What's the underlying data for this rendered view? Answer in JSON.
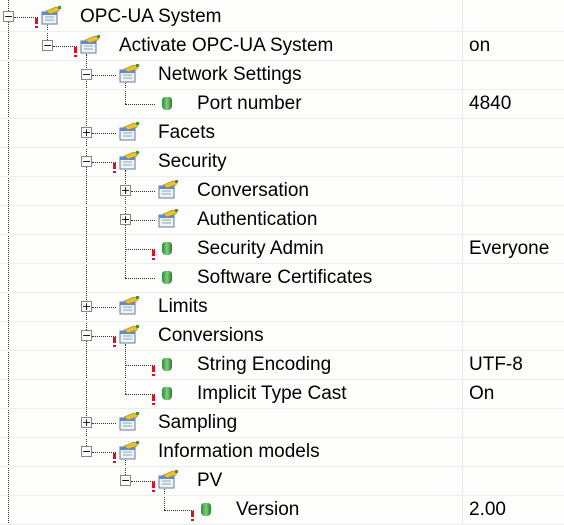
{
  "tree": [
    {
      "level": 0,
      "expander": "minus",
      "flag": true,
      "icon": "folder-settings",
      "label": "OPC-UA System",
      "value": ""
    },
    {
      "level": 1,
      "expander": "minus",
      "flag": true,
      "icon": "folder-settings",
      "label": "Activate OPC-UA System",
      "value": "on"
    },
    {
      "level": 2,
      "expander": "minus",
      "flag": false,
      "icon": "folder-settings",
      "label": "Network Settings",
      "value": ""
    },
    {
      "level": 3,
      "expander": "none",
      "flag": false,
      "icon": "green-gem",
      "label": "Port number",
      "value": "4840"
    },
    {
      "level": 2,
      "expander": "plus",
      "flag": false,
      "icon": "folder-settings",
      "label": "Facets",
      "value": ""
    },
    {
      "level": 2,
      "expander": "minus",
      "flag": true,
      "icon": "folder-settings",
      "label": "Security",
      "value": ""
    },
    {
      "level": 3,
      "expander": "plus",
      "flag": false,
      "icon": "folder-settings",
      "label": "Conversation",
      "value": ""
    },
    {
      "level": 3,
      "expander": "plus",
      "flag": false,
      "icon": "folder-settings",
      "label": "Authentication",
      "value": ""
    },
    {
      "level": 3,
      "expander": "none",
      "flag": true,
      "icon": "green-gem",
      "label": "Security Admin",
      "value": "Everyone"
    },
    {
      "level": 3,
      "expander": "none",
      "flag": false,
      "icon": "green-gem",
      "label": "Software Certificates",
      "value": ""
    },
    {
      "level": 2,
      "expander": "plus",
      "flag": false,
      "icon": "folder-settings",
      "label": "Limits",
      "value": ""
    },
    {
      "level": 2,
      "expander": "minus",
      "flag": true,
      "icon": "folder-settings",
      "label": "Conversions",
      "value": ""
    },
    {
      "level": 3,
      "expander": "none",
      "flag": true,
      "icon": "green-gem",
      "label": "String Encoding",
      "value": "UTF-8"
    },
    {
      "level": 3,
      "expander": "none",
      "flag": true,
      "icon": "green-gem",
      "label": "Implicit Type Cast",
      "value": "On"
    },
    {
      "level": 2,
      "expander": "plus",
      "flag": false,
      "icon": "folder-settings",
      "label": "Sampling",
      "value": ""
    },
    {
      "level": 2,
      "expander": "minus",
      "flag": true,
      "icon": "folder-settings",
      "label": "Information models",
      "value": ""
    },
    {
      "level": 3,
      "expander": "minus",
      "flag": true,
      "icon": "folder-settings",
      "label": "PV",
      "value": ""
    },
    {
      "level": 4,
      "expander": "none",
      "flag": true,
      "icon": "green-gem",
      "label": "Version",
      "value": "2.00"
    }
  ]
}
